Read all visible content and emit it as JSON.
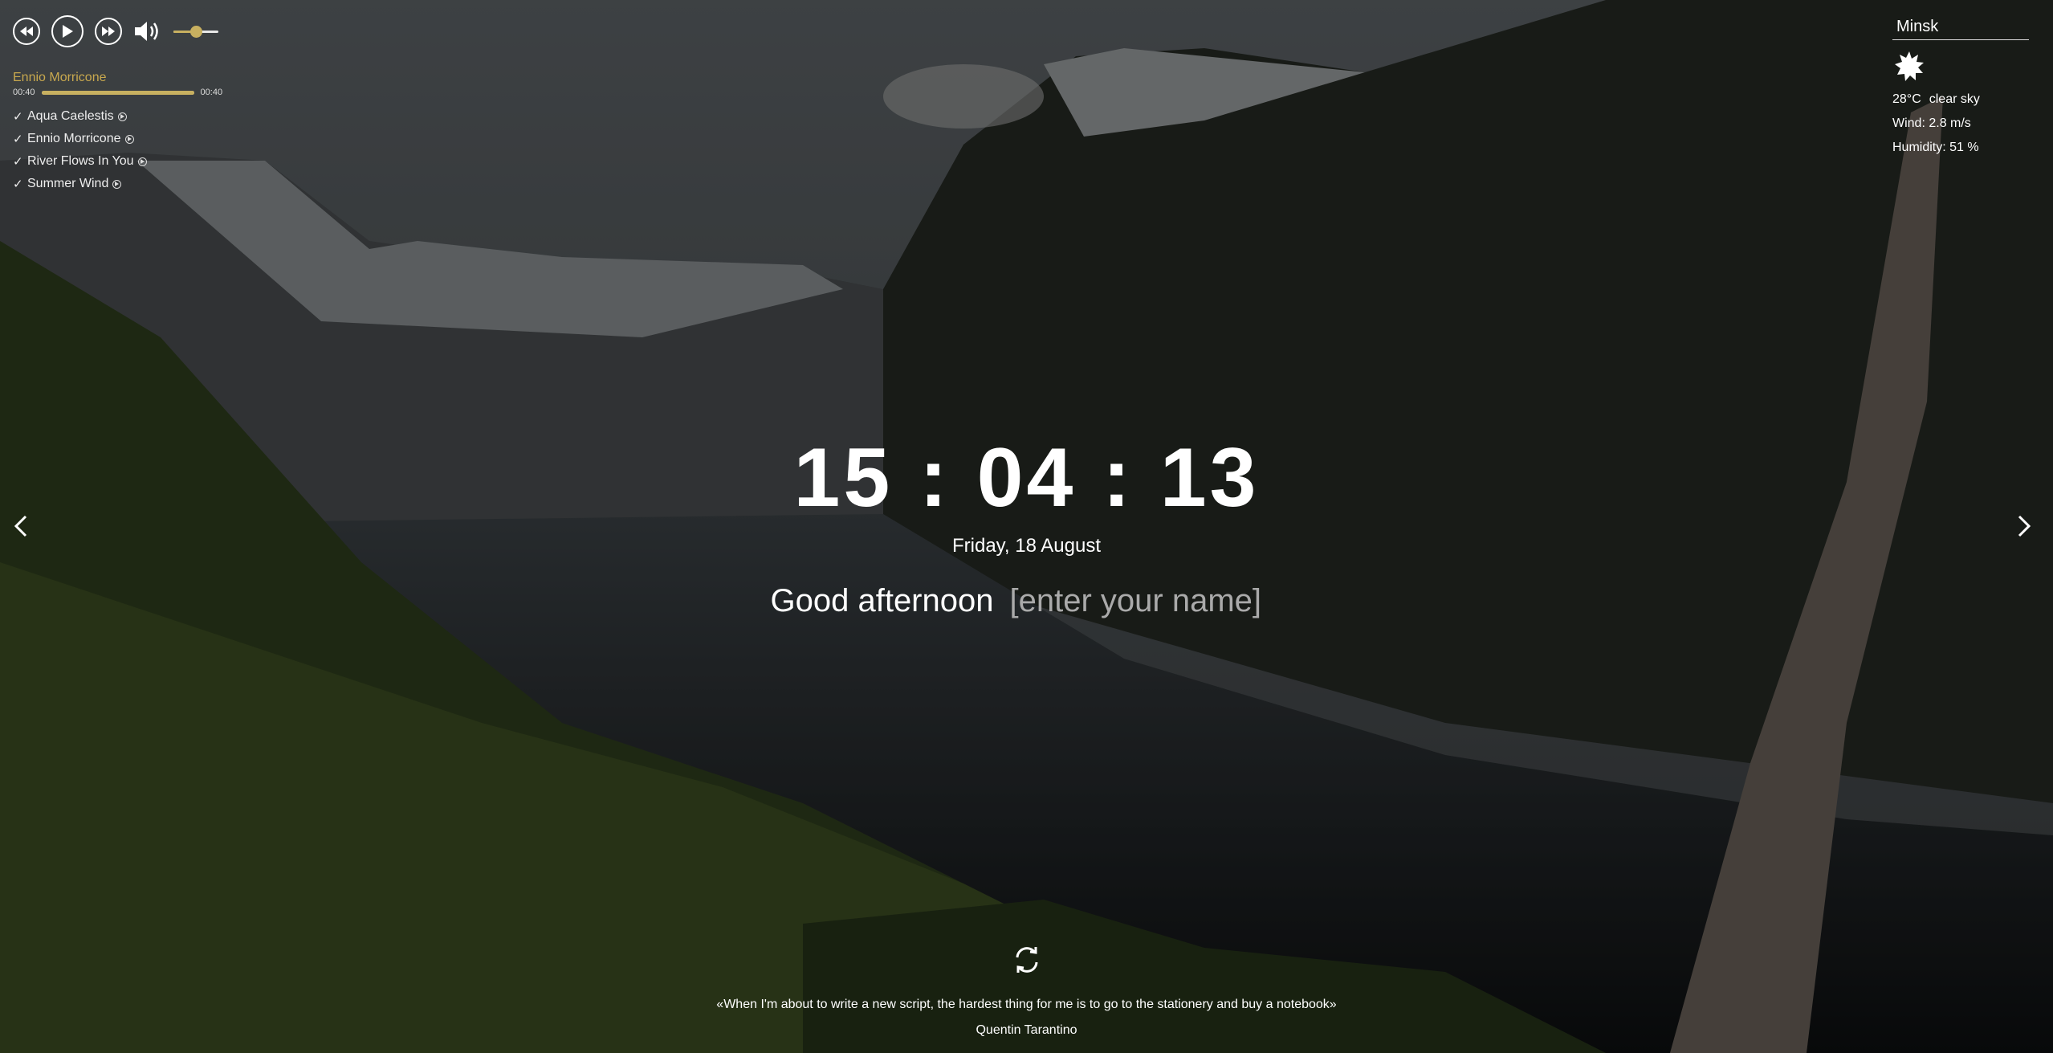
{
  "player": {
    "icons": {
      "prev": "previous-track-icon",
      "play": "play-icon",
      "next": "next-track-icon",
      "volume": "volume-icon"
    },
    "volume_level": 0.5,
    "now_playing": "Ennio Morricone",
    "time_current": "00:40",
    "time_total": "00:40",
    "progress": 1.0,
    "playlist": [
      {
        "title": "Aqua Caelestis",
        "check": "✓"
      },
      {
        "title": "Ennio Morricone",
        "check": "✓"
      },
      {
        "title": "River Flows In You",
        "check": "✓"
      },
      {
        "title": "Summer Wind",
        "check": "✓"
      }
    ]
  },
  "weather": {
    "city": "Minsk",
    "icon": "sun-icon",
    "temperature": "28°C",
    "description": "clear sky",
    "wind": "Wind: 2.8 m/s",
    "humidity": "Humidity: 51 %"
  },
  "slider": {
    "prev_icon": "chevron-left-icon",
    "next_icon": "chevron-right-icon"
  },
  "clock": {
    "time": "15:04:13",
    "date": "Friday, 18 August"
  },
  "greeting": {
    "text": "Good afternoon",
    "name_placeholder": "[enter your name]"
  },
  "quote": {
    "refresh_icon": "refresh-icon",
    "text": "«When I'm about to write a new script, the hardest thing for me is to go to the stationery and buy a notebook»",
    "author": "Quentin Tarantino"
  },
  "colors": {
    "accent": "#c8a84e",
    "text": "#ffffff"
  }
}
